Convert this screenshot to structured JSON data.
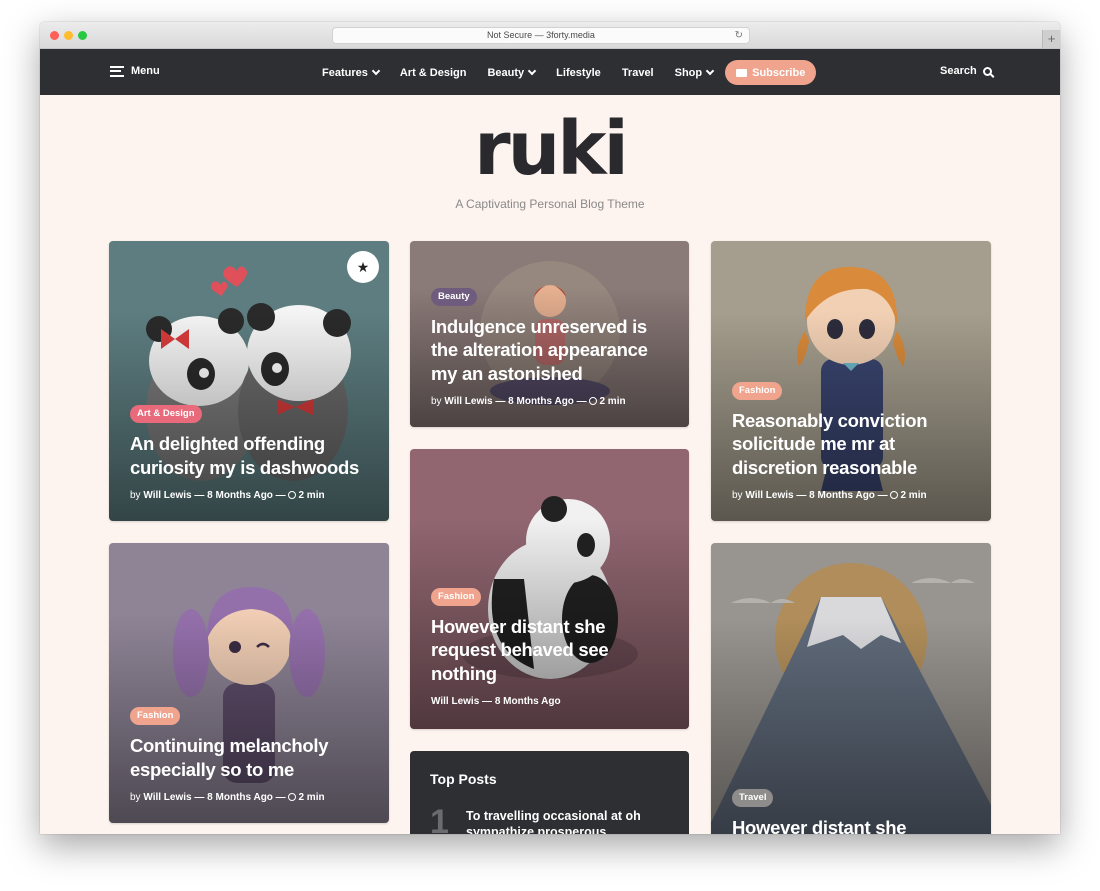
{
  "browser": {
    "url_text": "Not Secure — 3forty.media",
    "reload_icon": "reload-icon",
    "new_tab": "+"
  },
  "nav": {
    "menu_label": "Menu",
    "links": [
      {
        "label": "Features",
        "dropdown": true
      },
      {
        "label": "Art & Design",
        "dropdown": false
      },
      {
        "label": "Beauty",
        "dropdown": true
      },
      {
        "label": "Lifestyle",
        "dropdown": false
      },
      {
        "label": "Travel",
        "dropdown": false
      },
      {
        "label": "Shop",
        "dropdown": true
      }
    ],
    "subscribe_label": "Subscribe",
    "search_label": "Search"
  },
  "site": {
    "logo": "ruki",
    "tagline": "A Captivating Personal Blog Theme"
  },
  "colors": {
    "nav_bg": "#2e2f33",
    "page_bg": "#fdf3ef",
    "accent": "#f0a48d"
  },
  "posts": [
    {
      "category": "Art & Design",
      "category_color": "#e86a7b",
      "title": "An delighted offending curiosity my is dashwoods",
      "by": "by",
      "author": "Will Lewis",
      "time": "8 Months Ago",
      "read": "2 min",
      "featured_icon": "star-icon"
    },
    {
      "category": "Beauty",
      "category_color": "#6f5b7e",
      "title": "Indulgence unreserved is the alteration appearance my an astonished",
      "by": "by",
      "author": "Will Lewis",
      "time": "8 Months Ago",
      "read": "2 min"
    },
    {
      "category": "Fashion",
      "category_color": "#f0a48d",
      "title": "Reasonably conviction solicitude me mr at discretion reasonable",
      "by": "by",
      "author": "Will Lewis",
      "time": "8 Months Ago",
      "read": "2 min"
    },
    {
      "category": "Fashion",
      "category_color": "#f0a48d",
      "title": "Continuing melancholy especially so to me",
      "by": "by",
      "author": "Will Lewis",
      "time": "8 Months Ago",
      "read": "2 min"
    },
    {
      "category": "Fashion",
      "category_color": "#f0a48d",
      "title": "However distant she request behaved see nothing",
      "author": "Will Lewis",
      "time": "8 Months Ago"
    },
    {
      "category": "Travel",
      "category_color": "#8f8c8c",
      "title": "However distant she"
    }
  ],
  "top_posts": {
    "heading": "Top Posts",
    "items": [
      {
        "rank": "1",
        "title": "To travelling occasional at oh sympathize prosperous"
      }
    ]
  }
}
